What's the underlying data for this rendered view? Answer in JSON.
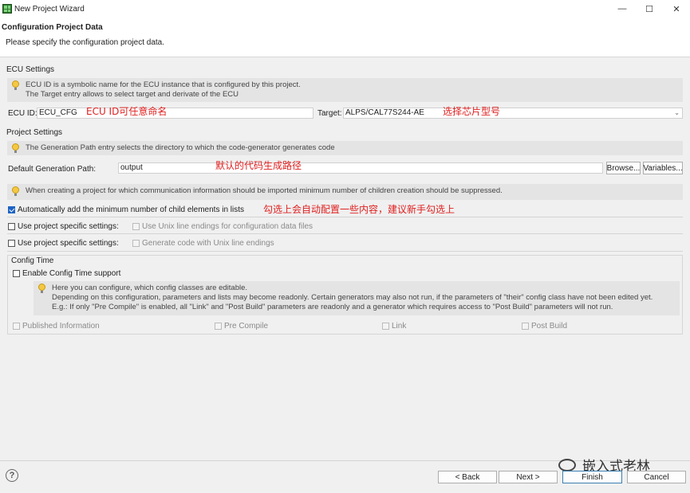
{
  "window": {
    "title": "New Project Wizard",
    "minimize": "—",
    "maximize": "☐",
    "close": "✕"
  },
  "header": {
    "title": "Configuration Project Data",
    "description": "Please specify the configuration project data."
  },
  "ecu": {
    "section_label": "ECU Settings",
    "hint_line1": "ECU ID is a symbolic name for the ECU instance that is configured by this project.",
    "hint_line2": "The Target entry allows to select target and derivate of the ECU",
    "ecu_id_label": "ECU ID:",
    "ecu_id_value": "ECU_CFG",
    "ecu_id_annotation": "ECU ID可任意命名",
    "target_label": "Target:",
    "target_value": "ALPS/CAL77S244-AE",
    "target_annotation": "选择芯片型号"
  },
  "project": {
    "section_label": "Project Settings",
    "hint": "The Generation Path entry selects the directory to which the code-generator generates code",
    "path_label": "Default Generation Path:",
    "path_value": "output",
    "path_annotation": "默认的代码生成路径",
    "browse_label": "Browse...",
    "variables_label": "Variables...",
    "min_hint": "When creating a project for which communication information should be imported minimum number of children creation should be suppressed.",
    "auto_add_label": "Automatically add the minimum number of child elements in lists",
    "auto_add_checked": true,
    "auto_add_annotation": "勾选上会自动配置一些内容，建议新手勾选上",
    "specific1_label": "Use project specific settings:",
    "unix_config_label": "Use Unix line endings for configuration data files",
    "specific2_label": "Use project specific settings:",
    "unix_gen_label": "Generate code with Unix line endings"
  },
  "config_time": {
    "section_label": "Config Time",
    "enable_label": "Enable Config Time support",
    "hint_line1": "Here you can configure, which config classes are editable.",
    "hint_line2": "Depending on this configuration, parameters and lists may become readonly. Certain generators may also not run, if the parameters of \"their\" config class have not been edited yet.",
    "hint_line3": "E.g.: If only \"Pre Compile\" is enabled, all \"Link\" and \"Post Build\" parameters are readonly and a generator which requires access to \"Post Build\" parameters will not run.",
    "published_label": "Published Information",
    "pre_compile_label": "Pre Compile",
    "link_label": "Link",
    "post_build_label": "Post Build"
  },
  "footer": {
    "help": "?",
    "back_label": "< Back",
    "next_label": "Next >",
    "finish_label": "Finish",
    "cancel_label": "Cancel",
    "watermark": "嵌入式老林"
  }
}
